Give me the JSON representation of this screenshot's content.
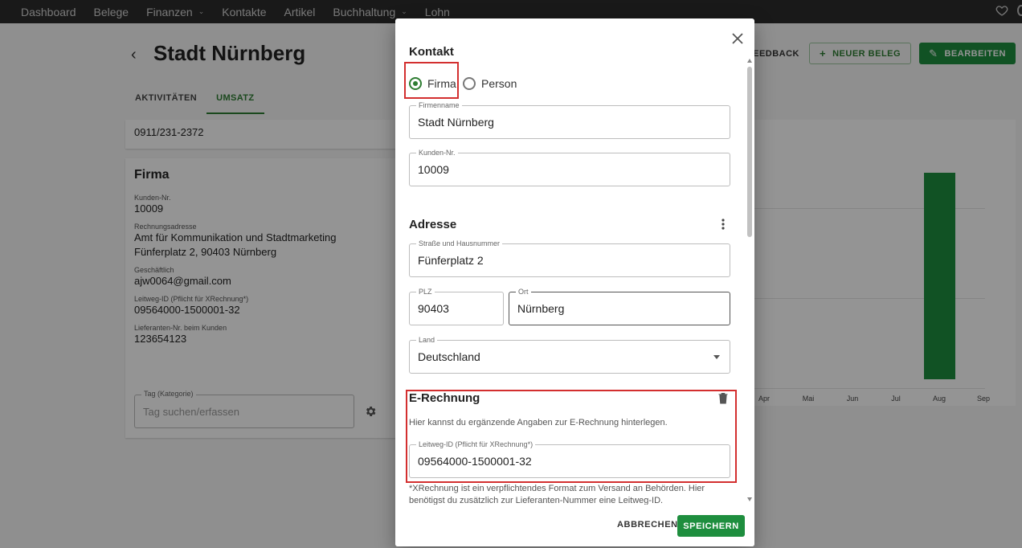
{
  "topnav": {
    "items": [
      {
        "label": "Dashboard",
        "has_caret": false
      },
      {
        "label": "Belege",
        "has_caret": false
      },
      {
        "label": "Finanzen",
        "has_caret": true
      },
      {
        "label": "Kontakte",
        "has_caret": false
      },
      {
        "label": "Artikel",
        "has_caret": false
      },
      {
        "label": "Buchhaltung",
        "has_caret": true
      },
      {
        "label": "Lohn",
        "has_caret": false
      }
    ],
    "right_icons": [
      "heart-icon"
    ]
  },
  "page": {
    "title": "Stadt Nürnberg",
    "tabs": [
      {
        "label": "AKTIVITÄTEN",
        "active": false
      },
      {
        "label": "UMSATZ",
        "active": true
      }
    ],
    "phone": "0911/231-2372",
    "actions": {
      "feedback": "FEEDBACK",
      "new_document": "NEUER BELEG",
      "edit": "BEARBEITEN"
    },
    "firma_card": {
      "heading": "Firma",
      "fields": [
        {
          "label": "Kunden-Nr.",
          "value": [
            "10009"
          ]
        },
        {
          "label": "Rechnungsadresse",
          "value": [
            "Amt für Kommunikation und Stadtmarketing",
            "Fünferplatz 2, 90403 Nürnberg"
          ]
        },
        {
          "label": "Geschäftlich",
          "value": [
            "ajw0064@gmail.com"
          ]
        },
        {
          "label": "Leitweg-ID (Pflicht für XRechnung*)",
          "value": [
            "09564000-1500001-32"
          ]
        },
        {
          "label": "Lieferanten-Nr. beim Kunden",
          "value": [
            "123654123"
          ]
        }
      ],
      "tag_label": "Tag (Kategorie)",
      "tag_placeholder": "Tag suchen/erfassen"
    },
    "chart": {
      "x_ticks": [
        "Apr",
        "Mai",
        "Jun",
        "Jul",
        "Aug",
        "Sep"
      ],
      "accent": "#1e8e3e"
    }
  },
  "dialog": {
    "contact_heading": "Kontakt",
    "type_options": [
      {
        "label": "Firma",
        "selected": true
      },
      {
        "label": "Person",
        "selected": false
      }
    ],
    "company_name": {
      "label": "Firmenname",
      "value": "Stadt Nürnberg"
    },
    "customer_no": {
      "label": "Kunden-Nr.",
      "value": "10009"
    },
    "address_heading": "Adresse",
    "street": {
      "label": "Straße und Hausnummer",
      "value": "Fünferplatz 2"
    },
    "zip": {
      "label": "PLZ",
      "value": "90403"
    },
    "city": {
      "label": "Ort",
      "value": "Nürnberg"
    },
    "country": {
      "label": "Land",
      "value": "Deutschland"
    },
    "erechnung_heading": "E-Rechnung",
    "erechnung_hint": "Hier kannst du ergänzende Angaben zur E-Rechnung hinterlegen.",
    "leitweg": {
      "label": "Leitweg-ID (Pflicht für XRechnung*)",
      "value": "09564000-1500001-32"
    },
    "xrechnung_note": "*XRechnung ist ein verpflichtendes Format zum Versand an Behörden. Hier benötigst du zusätzlich zur Lieferanten-Nummer eine Leitweg-ID.",
    "cancel": "ABBRECHEN",
    "save": "SPEICHERN"
  },
  "colors": {
    "accent_green": "#1e8e3e",
    "highlight_red": "#d32f2f",
    "nav_bg": "#2c2c2c"
  }
}
